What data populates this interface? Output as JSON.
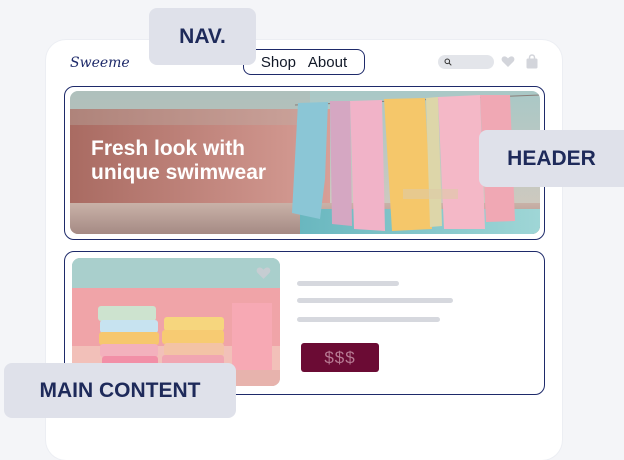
{
  "brand": {
    "logo": "Sweeme"
  },
  "nav": {
    "items": [
      "Shop",
      "About"
    ]
  },
  "icons": {
    "search": "search-icon",
    "favorite": "heart-icon",
    "cart": "bag-icon"
  },
  "hero": {
    "title": "Fresh look with unique swimwear"
  },
  "product": {
    "price_label": "$$$"
  },
  "labels": {
    "nav": "NAV.",
    "header": "HEADER",
    "main": "MAIN CONTENT"
  },
  "colors": {
    "accent": "#1e2a6a",
    "price_button": "#6b0b34",
    "tag_bg": "#dfe1ea",
    "placeholder_line": "#d6d8de"
  }
}
